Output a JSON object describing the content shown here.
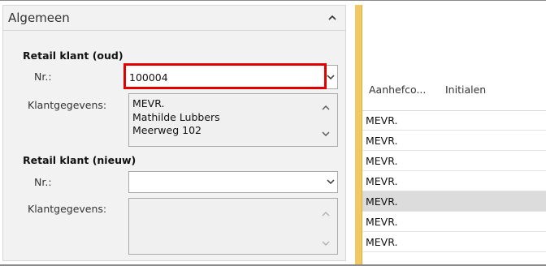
{
  "section": {
    "title": "Algemeen"
  },
  "old_customer": {
    "title": "Retail klant (oud)",
    "nr_label": "Nr.:",
    "nr_value": "100004",
    "details_label": "Klantgegevens:",
    "details_lines": [
      "MEVR.",
      "Mathilde Lubbers",
      "Meerweg 102"
    ]
  },
  "new_customer": {
    "title": "Retail klant (nieuw)",
    "nr_label": "Nr.:",
    "nr_value": "",
    "details_label": "Klantgegevens:"
  },
  "grid": {
    "columns": [
      "Aanhefco...",
      "Initialen"
    ],
    "rows": [
      {
        "aanhef": "MEVR.",
        "selected": false
      },
      {
        "aanhef": "MEVR.",
        "selected": false
      },
      {
        "aanhef": "MEVR.",
        "selected": false
      },
      {
        "aanhef": "MEVR.",
        "selected": false
      },
      {
        "aanhef": "MEVR.",
        "selected": true
      },
      {
        "aanhef": "MEVR.",
        "selected": false
      },
      {
        "aanhef": "MEVR.",
        "selected": false
      }
    ]
  },
  "colors": {
    "highlight": "#e00000",
    "splitter": "#f0c864",
    "selected_row": "#dcdcdc"
  },
  "icons": [
    "chevron-up-icon",
    "chevron-down-icon"
  ]
}
